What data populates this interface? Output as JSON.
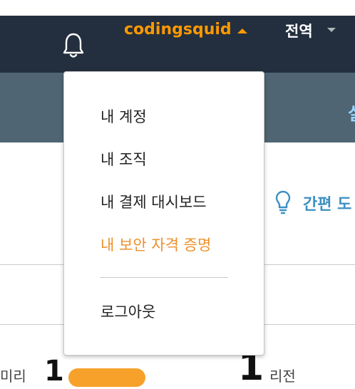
{
  "topbar": {
    "username": "codingsquid",
    "region": "전역",
    "icons": {
      "notifications": "bell-icon",
      "user_caret": "caret-up-icon",
      "region_caret": "caret-down-icon"
    }
  },
  "subbar": {
    "partial_text": "실"
  },
  "hint": {
    "icon": "lightbulb-icon",
    "text": "간편 도"
  },
  "bottom": {
    "left_text": "미리",
    "num1": "1",
    "num2": "1",
    "right_text": "리전"
  },
  "account_menu": {
    "items": [
      {
        "label": "내 계정"
      },
      {
        "label": "내 조직"
      },
      {
        "label": "내 결제 대시보드"
      },
      {
        "label": "내 보안 자격 증명",
        "active": true
      }
    ],
    "logout": "로그아웃"
  },
  "colors": {
    "accent": "#ff9900",
    "active_item": "#ec912d",
    "topbar_bg": "#232f3e",
    "subbar_bg": "#4f6574",
    "hint_blue": "#3d8fc2"
  }
}
